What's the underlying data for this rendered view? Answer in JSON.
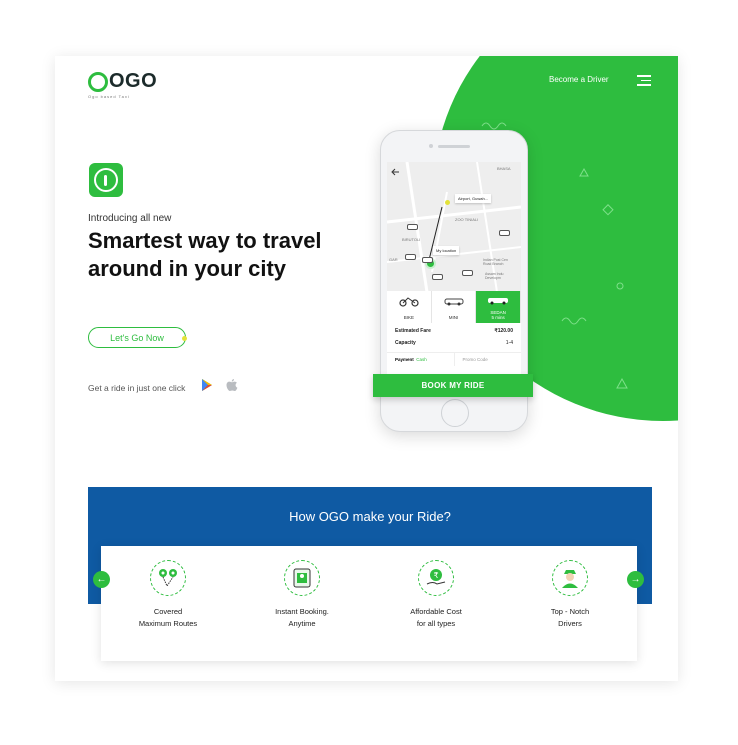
{
  "brand": {
    "name": "OGO",
    "tagline": "Ogo based Taxi"
  },
  "nav": {
    "become_driver": "Become a Driver",
    "menu_icon": "hamburger-menu-icon"
  },
  "hero": {
    "intro": "Introducing all new",
    "headline": "Smartest way to travel around in your city",
    "cta": "Let's Go Now",
    "store_text": "Get a ride in just one click",
    "stores": [
      "google-play-icon",
      "apple-icon"
    ]
  },
  "app": {
    "map_labels": [
      "BHASA",
      "Airport, Guwah...",
      "ZOO TINIALI",
      "BIRUTOLI",
      "My location",
      "GAR",
      "Indian Post Cen Road Branch",
      "Assam Indu Developm"
    ],
    "vehicles": [
      {
        "label": "BIKE"
      },
      {
        "label": "MINI"
      },
      {
        "label": "SEDAN",
        "eta": "5 mins"
      }
    ],
    "fare_label": "Estimated Fare",
    "fare_value": "₹120.00",
    "capacity_label": "Capacity",
    "capacity_value": "1-4",
    "payment_label": "Payment",
    "payment_value": "Cash",
    "promo_label": "Promo Code",
    "book_button": "BOOK MY RIDE"
  },
  "section": {
    "title": "How OGO make your Ride?",
    "features": [
      {
        "line1": "Covered",
        "line2": "Maximum Routes",
        "icon": "route-pins-icon"
      },
      {
        "line1": "Instant Booking.",
        "line2": "Anytime",
        "icon": "map-tablet-icon"
      },
      {
        "line1": "Affordable Cost",
        "line2": "for all types",
        "icon": "rupee-coin-hand-icon"
      },
      {
        "line1": "Top - Notch",
        "line2": "Drivers",
        "icon": "driver-icon"
      }
    ]
  },
  "colors": {
    "accent": "#2ebd3f",
    "band": "#0f5aa3"
  }
}
